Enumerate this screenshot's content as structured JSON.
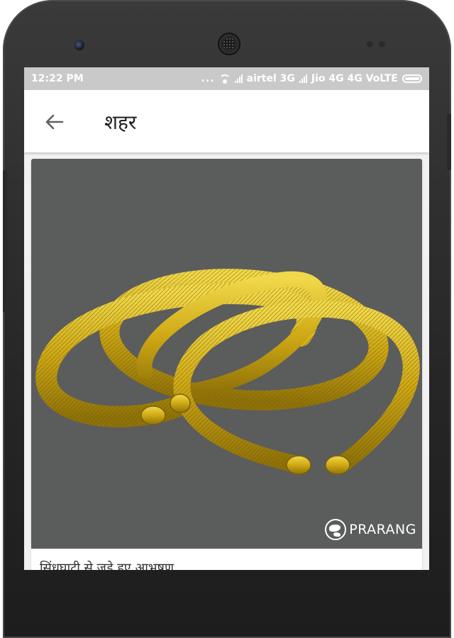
{
  "status_bar": {
    "time": "12:22 PM",
    "dots": "...",
    "carrier1": "airtel 3G",
    "carrier2": "Jio 4G 4G VoLTE"
  },
  "app_bar": {
    "title": "शहर",
    "back_icon": "arrow-left-icon"
  },
  "card": {
    "watermark": "PRARANG",
    "caption": "सिंधघाटी से जुड़े हुए आभूषण"
  },
  "colors": {
    "status_bar_bg": "#c9c9c9",
    "app_bar_bg": "#ffffff",
    "image_bg": "#5b5c5c",
    "gold": "#d9b71e"
  }
}
